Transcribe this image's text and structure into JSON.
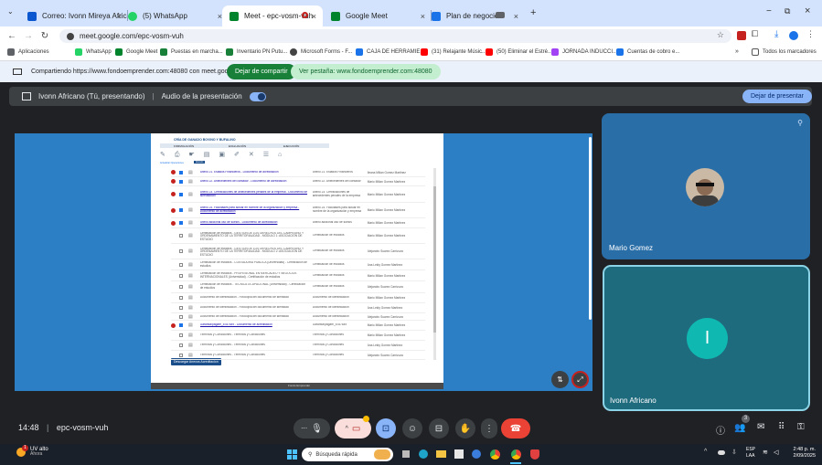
{
  "browser": {
    "tabs": [
      {
        "label": "Correo: Ivonn Mireya Africano R",
        "color": "#0b57d0"
      },
      {
        "label": "(5) WhatsApp",
        "color": "#25d366"
      },
      {
        "label": "Meet - epc-vosm-vuh",
        "color": "#00832d"
      },
      {
        "label": "Google Meet",
        "color": "#00832d"
      },
      {
        "label": "Plan de negocio",
        "color": "#1a73e8"
      }
    ],
    "url": "meet.google.com/epc-vosm-vuh",
    "bookmarks": [
      "Aplicaciones",
      "WhatsApp",
      "Google Meet",
      "Puestas en marcha...",
      "Inventario PN Putu...",
      "Microsoft Forms - F...",
      "CAJA DE HERRAMIE...",
      "(31) Relajante Músic...",
      "(50) Eliminar el Estré...",
      "JORNADA INDUCCI...",
      "Cuentas de cobro e..."
    ],
    "all_bookmarks": "Todos los marcadores"
  },
  "sharebar": {
    "message": "Compartiendo https://www.fondoemprender.com:48080 con meet.google.com",
    "stop_label": "Dejar de compartir",
    "view_label": "Ver pestaña: www.fondoemprender.com:48080"
  },
  "meet": {
    "presenter": "Ivonn Africano (Tú, presentando)",
    "audio_label": "Audio de la presentación",
    "stop_present_label": "Dejar de presentar",
    "participants": [
      {
        "name": "Mario Gomez"
      },
      {
        "name": "Ivonn Africano",
        "initial": "I"
      }
    ],
    "time": "14:48",
    "meeting_code": "epc-vosm-vuh",
    "people_count": "3"
  },
  "document": {
    "header": "CRÍA DE GANADO BOVINO Y BUFALINO",
    "tabs": [
      "FORMULACIÓN",
      "EVALUACIÓN",
      "EJECUCIÓN"
    ],
    "toolbar_note": "Actualizar Operaciones",
    "toolbar_badge": "Anexos",
    "rows": [
      {
        "text": "Anexo 21. Estados Financieros - Documento de acreditación",
        "type": "Anexo 21. Estados Financieros",
        "owner": "Ileana Milian Gomez Martinez",
        "flag": true,
        "link": true
      },
      {
        "text": "Anexo 22. Antecedentes del contador - Documento de acreditación",
        "type": "Anexo 22. Antecedentes del contador",
        "owner": "Mario Milian Gomez Martinez",
        "flag": true,
        "link": true
      },
      {
        "text": "Anexo 23. Certificaciones de antecedentes penales de la empresa - Documento de acreditación",
        "type": "Anexo 23. Certificaciones de antecedentes penales de la empresa",
        "owner": "Mario Milian Gomez Martinez",
        "flag": true,
        "link": true
      },
      {
        "text": "Anexo 24. Facultades para actuar en nombre de la organización y empresa - Documento de acreditación",
        "type": "Anexo 24. Facultades para actuar en nombre de la organización y empresa",
        "owner": "Mario Milian Gomez Martinez",
        "flag": true,
        "link": true
      },
      {
        "text": "Anexo adicional uso de suelos - Documento de acreditación",
        "type": "Anexo adicional uso de suelos",
        "owner": "Mario Milian Gomez Martinez",
        "flag": true,
        "link": true
      },
      {
        "text": "Certificación de estudios - GESTIÓN DE LOS DERECHOS DEL CAMPESINO Y ORDENAMIENTO DE LA TERRITORIALIDAD - MÓDULO 1: ASOCIACIÓN DE ESTUDIO",
        "type": "Certificación de estudios",
        "owner": "Mario Milian Gomez Martinez",
        "flag": false,
        "link": false
      },
      {
        "text": "Certificación de estudios - GESTIÓN DE LOS DERECHOS DEL CAMPESINO Y ORDENAMIENTO DE LA TERRITORIALIDAD - MÓDULO 2: ASOCIACIÓN DE ESTUDIO",
        "type": "Certificación de estudios",
        "owner": "Alejandro Suarez Carrizoza",
        "flag": false,
        "link": false
      },
      {
        "text": "Certificación de estudios - CONTADURÍA PÚBLICA (Universidad) - Certificación de estudios",
        "type": "Certificación de estudios",
        "owner": "Ana Leidy Gomez Martinez",
        "flag": false,
        "link": false
      },
      {
        "text": "Certificación de estudios - PROFESIONAL EN MERCADEO Y NEGOCIOS INTERNACIONALES (Universidad) - Certificación de estudios",
        "type": "Certificación de estudios",
        "owner": "Mario Milian Gomez Martinez",
        "flag": false,
        "link": false
      },
      {
        "text": "Certificación de estudios - TÉCNICA OCUPACIONAL (Universidad) - Certificación de estudios",
        "type": "Certificación de estudios",
        "owner": "Alejandro Suarez Carrizoza",
        "flag": false,
        "link": false
      },
      {
        "text": "Documento de identificación - Fotocopia del documento de identidad",
        "type": "Documento de identificación",
        "owner": "Mario Milian Gomez Martinez",
        "flag": false,
        "link": false
      },
      {
        "text": "Documento de identificación - Fotocopia del documento de identidad",
        "type": "Documento de identificación",
        "owner": "Ana Leidy Gomez Martinez",
        "flag": false,
        "link": false
      },
      {
        "text": "Documento de identificación - Fotocopia del documento de identidad",
        "type": "Documento de identificación",
        "owner": "Alejandro Suarez Carrizoza",
        "flag": false,
        "link": false
      },
      {
        "text": "Garantía/pagaré_8787849 - Documento de acreditación",
        "type": "Garantía/pagaré_8787849",
        "owner": "Mario Milian Gomez Martinez",
        "flag": true,
        "link": true
      },
      {
        "text": "Términos y Condiciones - Términos y Condiciones",
        "type": "Términos y Condiciones",
        "owner": "Mario Milian Gomez Martinez",
        "flag": false,
        "link": false
      },
      {
        "text": "Términos y Condiciones - Términos y Condiciones",
        "type": "Términos y Condiciones",
        "owner": "Ana Leidy Gomez Martinez",
        "flag": false,
        "link": false
      },
      {
        "text": "Términos y Condiciones - Términos y Condiciones",
        "type": "Términos y Condiciones",
        "owner": "Alejandro Suarez Carrizoza",
        "flag": false,
        "link": false
      }
    ],
    "download_label": "Descargar Anexos Acreditacion",
    "footer": "Fondo Emprender"
  },
  "taskbar": {
    "weather_title": "UV alto",
    "weather_sub": "Ahora",
    "search_placeholder": "Búsqueda rápida",
    "lang": "ESP",
    "lang_sub": "LAA",
    "clock_time": "2:48 p. m.",
    "clock_date": "2/09/2025",
    "notify_count": "1"
  },
  "colors": {
    "meet_bg": "#202124",
    "accent": "#8ab4f8",
    "share_green": "#188038",
    "stage_blue": "#2d7fc5",
    "end_call": "#ea4335"
  }
}
